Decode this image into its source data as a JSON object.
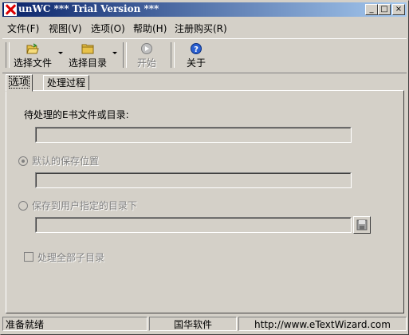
{
  "window": {
    "title": "unWC *** Trial Version ***"
  },
  "title_buttons": {
    "minimize": "_",
    "maximize": "□",
    "close": "×"
  },
  "menu": [
    {
      "label": "文件(F)"
    },
    {
      "label": "视图(V)"
    },
    {
      "label": "选项(O)"
    },
    {
      "label": "帮助(H)"
    },
    {
      "label": "注册购买(R)"
    }
  ],
  "toolbar": {
    "select_file": "选择文件",
    "select_dir": "选择目录",
    "start": "开始",
    "about": "关于"
  },
  "tabs": [
    {
      "label": "选项",
      "active": true
    },
    {
      "label": "处理过程",
      "active": false
    }
  ],
  "options": {
    "source_label": "待处理的E书文件或目录:",
    "source_value": "",
    "radio_default_label": "默认的保存位置",
    "radio_default_selected": true,
    "default_path_value": "",
    "radio_custom_label": "保存到用户指定的目录下",
    "radio_custom_selected": false,
    "custom_path_value": "",
    "subdirs_label": "处理全部子目录",
    "subdirs_checked": false
  },
  "status": {
    "ready": "准备就绪",
    "company": "国华软件",
    "url": "http://www.eTextWizard.com"
  }
}
